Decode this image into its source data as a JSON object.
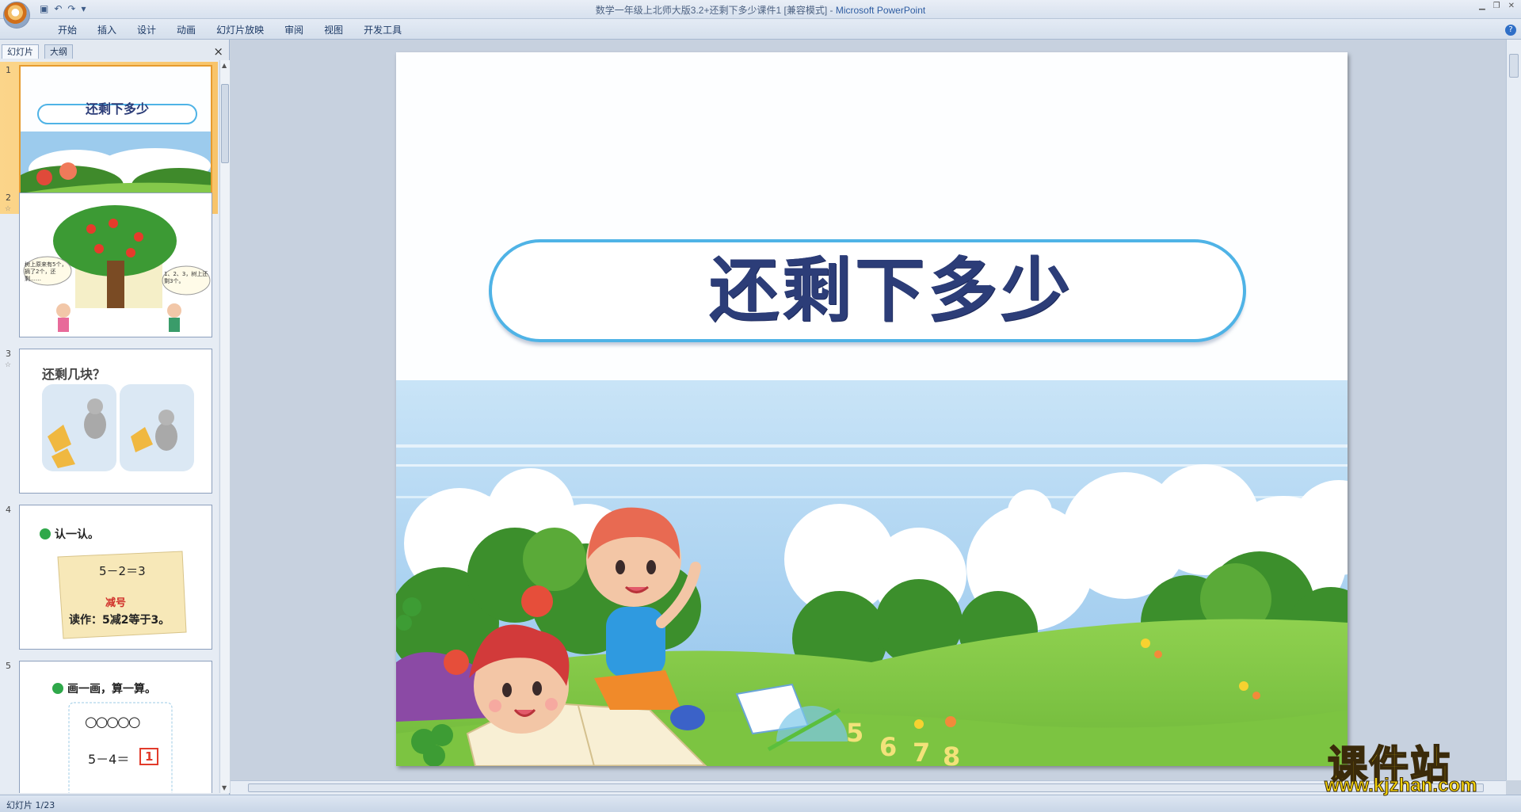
{
  "window": {
    "title": "数学一年级上北师大版3.2+还剩下多少课件1 [兼容模式]",
    "separator": " - ",
    "app_name": "Microsoft PowerPoint"
  },
  "ribbon": {
    "tabs": [
      "开始",
      "插入",
      "设计",
      "动画",
      "幻灯片放映",
      "审阅",
      "视图",
      "开发工具"
    ]
  },
  "panel": {
    "tabs": [
      "幻灯片",
      "大纲"
    ],
    "close_glyph": "×",
    "thumbnails": [
      {
        "num": "1",
        "title": "还剩下多少"
      },
      {
        "num": "2",
        "bubble_left": "树上原来有5个，摘了2个，还剩……",
        "bubble_right": "1、2、3，树上还剩3个。"
      },
      {
        "num": "3",
        "title": "还剩几块？"
      },
      {
        "num": "4",
        "heading": "认一认。",
        "equation": "5－2＝3",
        "label": "减号",
        "reading": "读作：5减2等于3。"
      },
      {
        "num": "5",
        "heading": "画一画，算一算。",
        "circles": "○○○○○",
        "equation": "5－4＝",
        "answer": "1"
      }
    ]
  },
  "slide": {
    "title": "还剩下多少",
    "colors": {
      "title": "#2c3d78",
      "pill_border": "#4fb3e6",
      "sky": "#8fc3ea",
      "grass": "#7cc441"
    }
  },
  "status": {
    "slide_indicator": "幻灯片 1/23"
  },
  "watermark": {
    "brand": "课件站",
    "url": "www.kjzhan.com"
  }
}
